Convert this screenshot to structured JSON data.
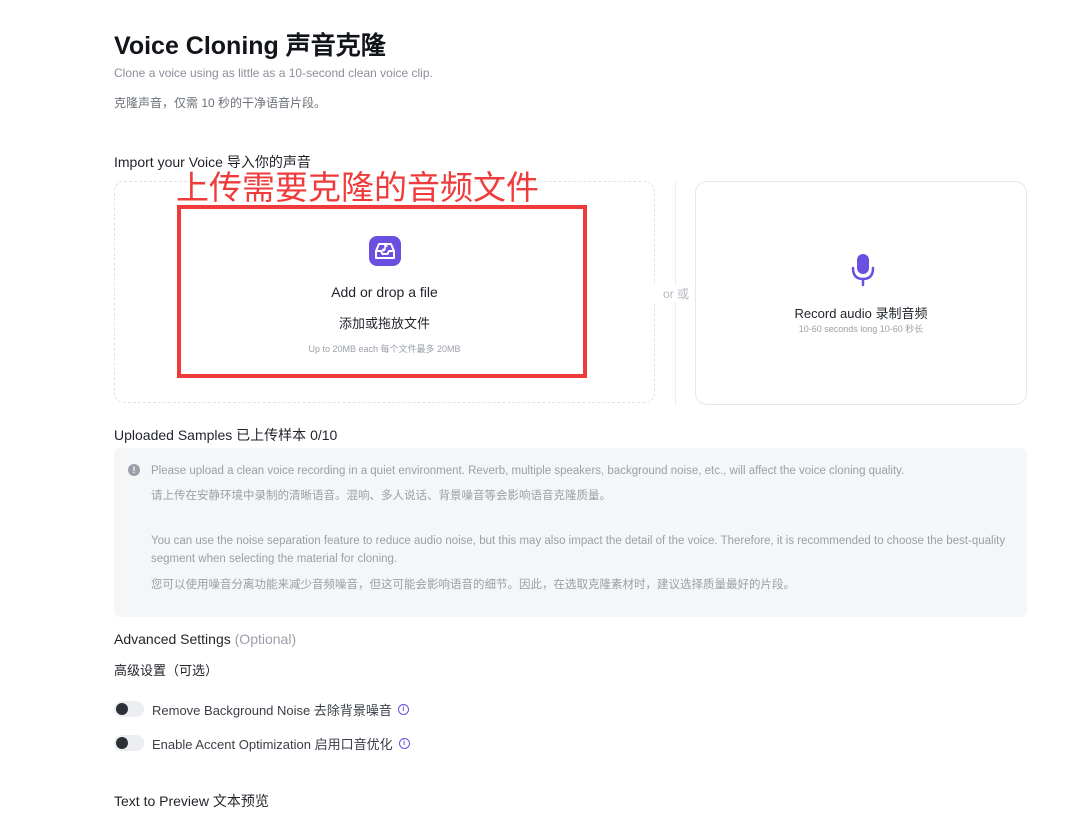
{
  "header": {
    "title": "Voice Cloning  声音克隆",
    "subtitle_en": "Clone a voice using as little as a 10-second clean voice clip.",
    "subtitle_cn": "克隆声音，仅需 10 秒的干净语音片段。"
  },
  "import": {
    "label": "Import your Voice  导入你的声音",
    "annotation": "上传需要克隆的音频文件",
    "add_file": "Add or drop a file",
    "add_file_cn": "添加或拖放文件",
    "limit": "Up to 20MB each  每个文件最多 20MB",
    "or_label": "or  或",
    "upload_icon": "upload-tray-icon",
    "record_title": "Record audio  录制音频",
    "record_sub": "10-60 seconds long  10-60 秒长",
    "record_icon": "microphone-icon"
  },
  "samples": {
    "label": "Uploaded Samples  已上传样本  0/10",
    "notice_icon": "!",
    "notice_1": "Please upload a clean voice recording in a quiet environment. Reverb, multiple speakers, background noise, etc., will affect the voice cloning quality.",
    "notice_2": "请上传在安静环境中录制的清晰语音。混响、多人说话、背景噪音等会影响语音克隆质量。",
    "notice_3": "You can use the noise separation feature to reduce audio noise, but this may also impact the detail of the voice. Therefore, it is recommended to choose the best-quality segment when selecting the material for cloning.",
    "notice_4": "您可以使用噪音分离功能来减少音频噪音，但这可能会影响语音的细节。因此，在选取克隆素材时，建议选择质量最好的片段。"
  },
  "advanced": {
    "label": "Advanced Settings ",
    "optional": "(Optional)",
    "label_cn": "高级设置（可选）",
    "toggles": [
      {
        "label": "Remove Background Noise   去除背景噪音",
        "enabled": false
      },
      {
        "label": "Enable Accent Optimization   启用口音优化",
        "enabled": false
      }
    ],
    "info_glyph": "i"
  },
  "preview": {
    "label": "Text to Preview  文本预览"
  },
  "colors": {
    "accent": "#6b4fe0",
    "annotation": "#ef3b3b"
  }
}
